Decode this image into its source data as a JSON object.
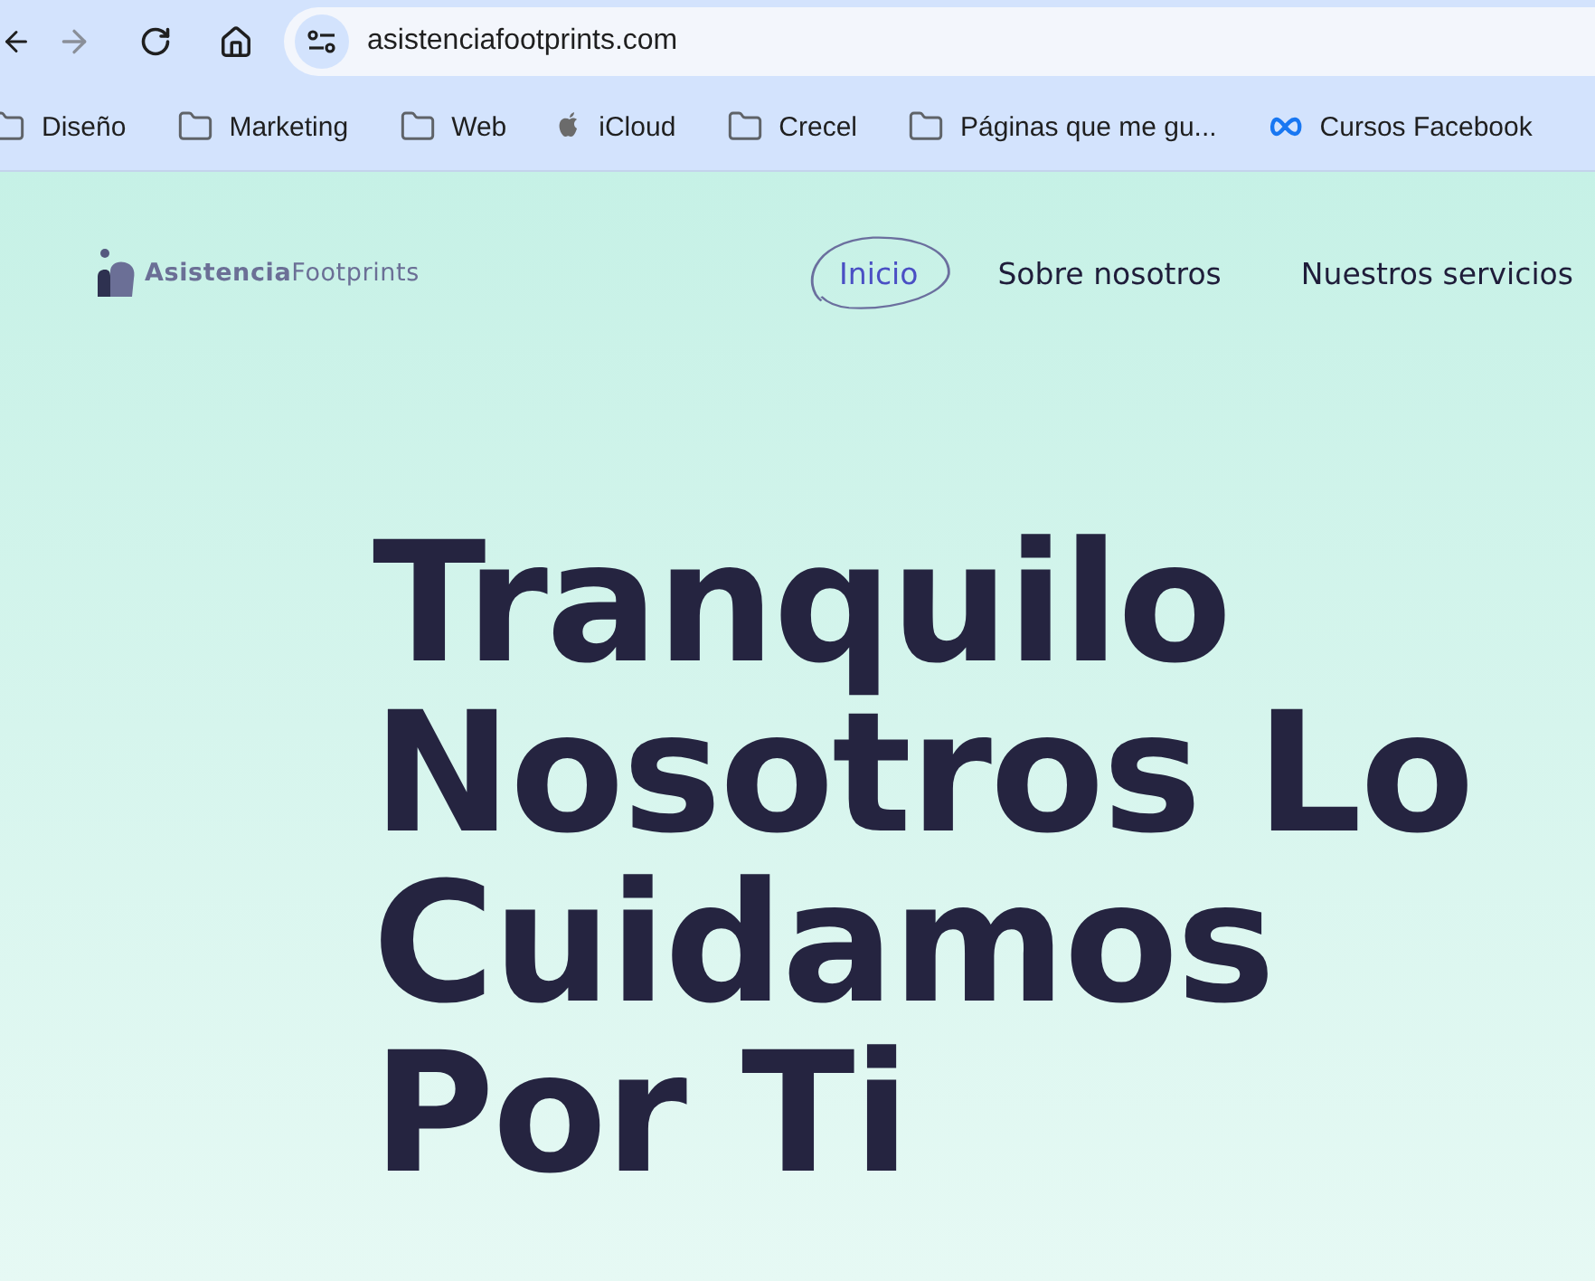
{
  "browser": {
    "address": "asistenciafootprints.com",
    "bookmarks": [
      {
        "kind": "folder",
        "label": "Diseño"
      },
      {
        "kind": "folder",
        "label": "Marketing"
      },
      {
        "kind": "folder",
        "label": "Web"
      },
      {
        "kind": "apple",
        "label": "iCloud"
      },
      {
        "kind": "folder",
        "label": "Crecel"
      },
      {
        "kind": "folder",
        "label": "Páginas que me gu..."
      },
      {
        "kind": "meta",
        "label": "Cursos Facebook"
      }
    ]
  },
  "site": {
    "logo": {
      "bold": "Asistencia",
      "light": "Footprints"
    },
    "nav": [
      {
        "label": "Inicio",
        "selected": true
      },
      {
        "label": "Sobre nosotros",
        "selected": false
      },
      {
        "label": "Nuestros servicios",
        "selected": false
      }
    ],
    "headline": "Tranquilo\nNosotros Lo\nCuidamos\nPor Ti"
  }
}
